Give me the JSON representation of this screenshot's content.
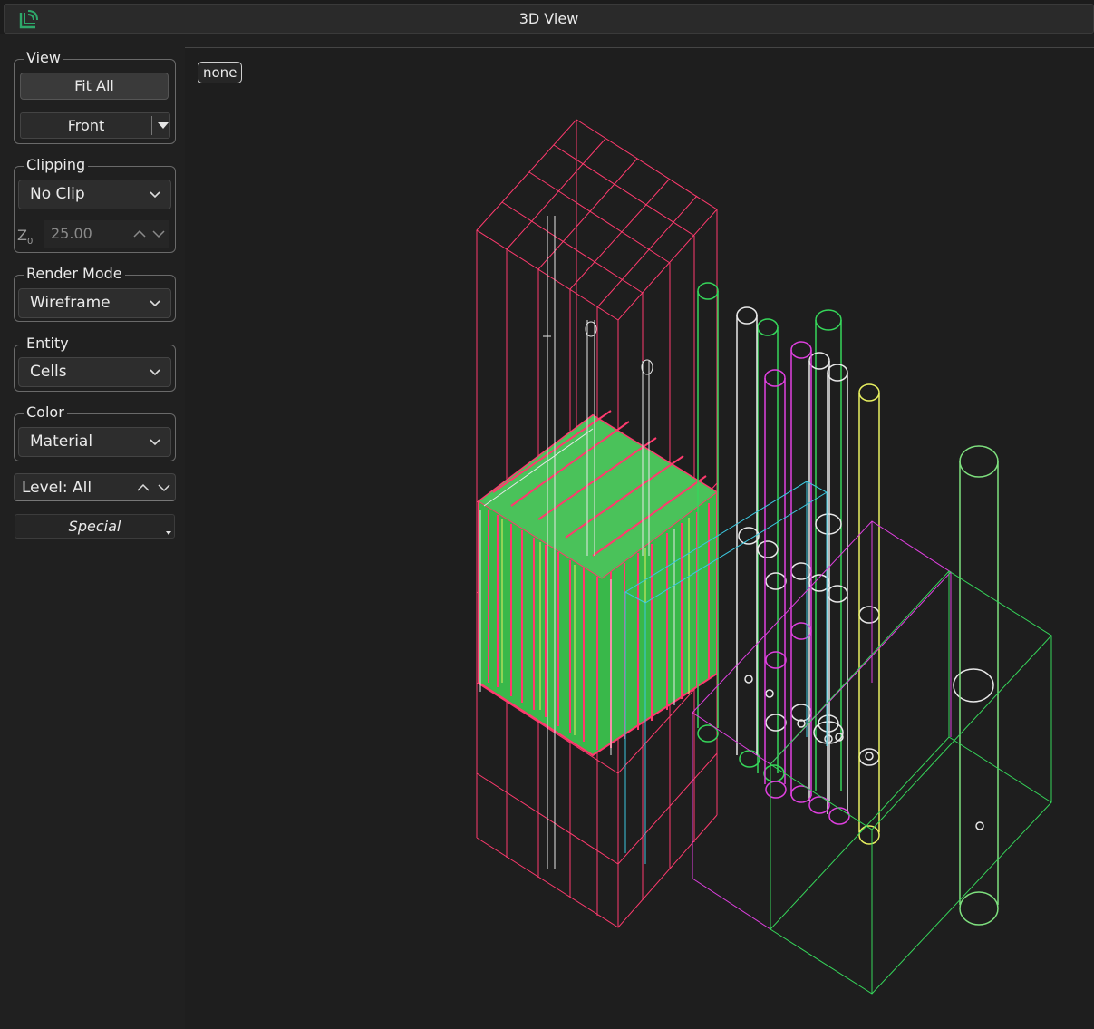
{
  "window": {
    "title": "3D View",
    "logo_icon": "app-logo-icon"
  },
  "sidebar": {
    "view": {
      "title": "View",
      "fit_all_label": "Fit All",
      "orientation_value": "Front"
    },
    "clipping": {
      "title": "Clipping",
      "mode_value": "No Clip",
      "z_label": "Z",
      "z_sub": "0",
      "z_value": "25.00"
    },
    "render_mode": {
      "title": "Render Mode",
      "value": "Wireframe"
    },
    "entity": {
      "title": "Entity",
      "value": "Cells"
    },
    "color": {
      "title": "Color",
      "value": "Material"
    },
    "level": {
      "label": "Level: All"
    },
    "special": {
      "label": "Special"
    }
  },
  "viewport": {
    "selection_badge": "none",
    "colors": {
      "red": "#ff3a6e",
      "green": "#36d65a",
      "white": "#e8e8e8",
      "magenta": "#e040e0",
      "cyan": "#3cc8e0",
      "yellow": "#e8f060",
      "lightgreen": "#7ee07e"
    }
  }
}
